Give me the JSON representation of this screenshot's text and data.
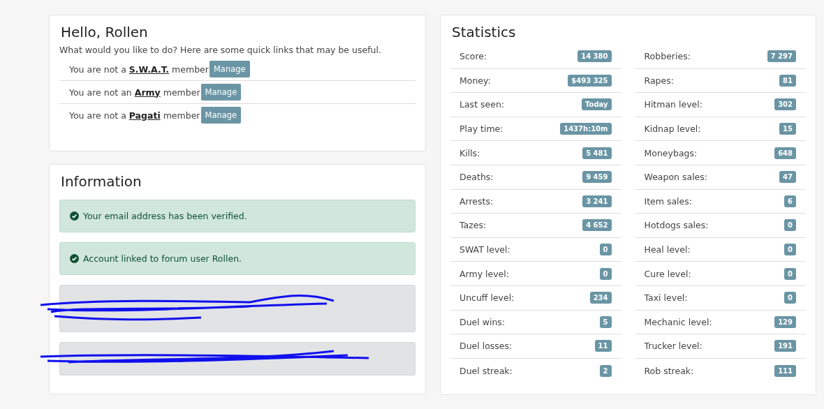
{
  "greeting": {
    "title": "Hello, Rollen",
    "intro": "What would you like to do? Here are some quick links that may be useful.",
    "memberships": [
      {
        "prefix": "You are not a",
        "group": "S.W.A.T.",
        "suffix": "member",
        "button": "Manage"
      },
      {
        "prefix": "You are not an",
        "group": "Army",
        "suffix": "member",
        "button": "Manage"
      },
      {
        "prefix": "You are not a",
        "group": "Pagati",
        "suffix": "member",
        "button": "Manage"
      }
    ]
  },
  "information": {
    "title": "Information",
    "alerts": [
      {
        "kind": "success",
        "text": "Your email address has been verified."
      },
      {
        "kind": "success",
        "text": "Account linked to forum user Rollen."
      },
      {
        "kind": "redacted"
      },
      {
        "kind": "redacted"
      }
    ]
  },
  "statistics": {
    "title": "Statistics",
    "columns": [
      [
        {
          "label": "Score:",
          "value": "14 380"
        },
        {
          "label": "Money:",
          "value": "$493 325"
        },
        {
          "label": "Last seen:",
          "value": "Today"
        },
        {
          "label": "Play time:",
          "value": "1437h:10m"
        },
        {
          "label": "Kills:",
          "value": "5 481"
        },
        {
          "label": "Deaths:",
          "value": "9 459"
        },
        {
          "label": "Arrests:",
          "value": "3 241"
        },
        {
          "label": "Tazes:",
          "value": "4 652"
        },
        {
          "label": "SWAT level:",
          "value": "0"
        },
        {
          "label": "Army level:",
          "value": "0"
        },
        {
          "label": "Uncuff level:",
          "value": "234"
        },
        {
          "label": "Duel wins:",
          "value": "5"
        },
        {
          "label": "Duel losses:",
          "value": "11"
        },
        {
          "label": "Duel streak:",
          "value": "2"
        }
      ],
      [
        {
          "label": "Robberies:",
          "value": "7 297"
        },
        {
          "label": "Rapes:",
          "value": "81"
        },
        {
          "label": "Hitman level:",
          "value": "302"
        },
        {
          "label": "Kidnap level:",
          "value": "15"
        },
        {
          "label": "Moneybags:",
          "value": "648"
        },
        {
          "label": "Weapon sales:",
          "value": "47"
        },
        {
          "label": "Item sales:",
          "value": "6"
        },
        {
          "label": "Hotdogs sales:",
          "value": "0"
        },
        {
          "label": "Heal level:",
          "value": "0"
        },
        {
          "label": "Cure level:",
          "value": "0"
        },
        {
          "label": "Taxi level:",
          "value": "0"
        },
        {
          "label": "Mechanic level:",
          "value": "129"
        },
        {
          "label": "Trucker level:",
          "value": "191"
        },
        {
          "label": "Rob streak:",
          "value": "111"
        }
      ]
    ]
  }
}
